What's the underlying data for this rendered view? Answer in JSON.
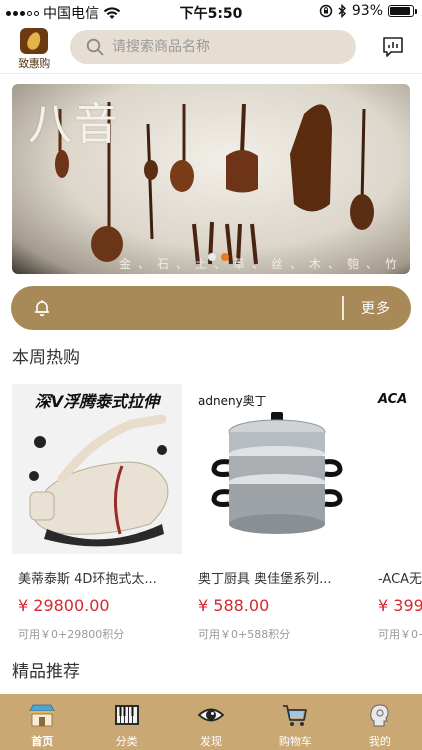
{
  "status_bar": {
    "carrier": "中国电信",
    "time": "下午5:50",
    "battery": "93%",
    "battery_level": 0.93
  },
  "header": {
    "logo_text": "致惠购",
    "search_placeholder": "请搜索商品名称",
    "icons": {
      "search": "search-icon",
      "message": "message-chart-icon"
    }
  },
  "banner": {
    "title": "八音",
    "caption": "金、石、土、革、丝、木、匏、竹",
    "slide_count": 2,
    "active_slide": 2
  },
  "notice": {
    "more_label": "更多",
    "icon": "bell-icon"
  },
  "sections": {
    "weekly_hot": "本周热购",
    "recommended": "精品推荐"
  },
  "products": [
    {
      "name": "美蒂泰斯 4D环抱式太...",
      "price": "¥ 29800.00",
      "points": "可用￥0+29800积分",
      "image_text": "深V浮腾泰式拉伸"
    },
    {
      "name": "奥丁厨具 奥佳堡系列...",
      "price": "¥ 588.00",
      "points": "可用￥0+588积分",
      "image_text": "adneny奥丁"
    },
    {
      "name": "-ACA无",
      "price": "¥ 399",
      "points": "可用￥0+",
      "image_text": "ACA"
    }
  ],
  "tabbar": {
    "items": [
      {
        "label": "首页",
        "icon": "storefront-icon"
      },
      {
        "label": "分类",
        "icon": "piano-keys-icon"
      },
      {
        "label": "发现",
        "icon": "eye-icon"
      },
      {
        "label": "购物车",
        "icon": "shopping-cart-icon"
      },
      {
        "label": "我的",
        "icon": "user-head-icon"
      }
    ],
    "active": 0
  },
  "colors": {
    "accent_gold": "#a88a58",
    "tabbar_bg": "#c9a874",
    "price_red": "#d7282f",
    "search_bg": "#e6ddd3",
    "dot_active": "#e97b1e"
  }
}
